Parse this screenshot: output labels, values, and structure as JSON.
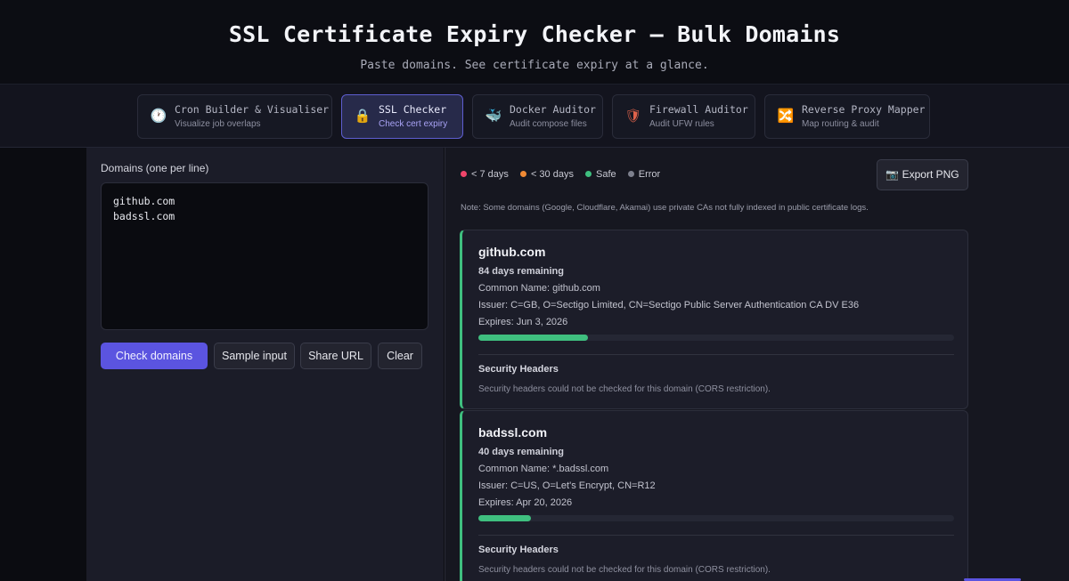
{
  "header": {
    "title": "SSL Certificate Expiry Checker — Bulk Domains",
    "subtitle": "Paste domains. See certificate expiry at a glance."
  },
  "nav": {
    "items": [
      {
        "icon": "🕐",
        "title": "Cron Builder & Visualiser",
        "subtitle": "Visualize job overlaps"
      },
      {
        "icon": "🔒",
        "title": "SSL Checker",
        "subtitle": "Check cert expiry"
      },
      {
        "icon": "🐳",
        "title": "Docker Auditor",
        "subtitle": "Audit compose files"
      },
      {
        "icon": "🛡",
        "title": "Firewall Auditor",
        "subtitle": "Audit UFW rules"
      },
      {
        "icon": "🔀",
        "title": "Reverse Proxy Mapper",
        "subtitle": "Map routing & audit"
      }
    ],
    "active_index": 1
  },
  "input_panel": {
    "label": "Domains (one per line)",
    "value": "github.com\nbadssl.com",
    "check_button": "Check domains",
    "sample_button": "Sample input",
    "share_button": "Share URL",
    "clear_button": "Clear"
  },
  "results": {
    "legend": [
      {
        "label": "< 7 days",
        "color": "#f0456a"
      },
      {
        "label": "< 30 days",
        "color": "#f08a34"
      },
      {
        "label": "Safe",
        "color": "#3fbf7f"
      },
      {
        "label": "Error",
        "color": "#7d808d"
      }
    ],
    "export_button": "📷 Export PNG",
    "note": "Note: Some domains (Google, Cloudflare, Akamai) use private CAs not fully indexed in public certificate logs.",
    "cards": [
      {
        "domain": "github.com",
        "days": "84 days remaining",
        "common_name": "Common Name: github.com",
        "issuer": "Issuer: C=GB, O=Sectigo Limited, CN=Sectigo Public Server Authentication CA DV E36",
        "expires": "Expires: Jun 3, 2026",
        "progress_fraction": 0.23,
        "security_title": "Security Headers",
        "security_text": "Security headers could not be checked for this domain (CORS restriction)."
      },
      {
        "domain": "badssl.com",
        "days": "40 days remaining",
        "common_name": "Common Name: *.badssl.com",
        "issuer": "Issuer: C=US, O=Let's Encrypt, CN=R12",
        "expires": "Expires: Apr 20, 2026",
        "progress_fraction": 0.11,
        "security_title": "Security Headers",
        "security_text": "Security headers could not be checked for this domain (CORS restriction)."
      }
    ]
  }
}
